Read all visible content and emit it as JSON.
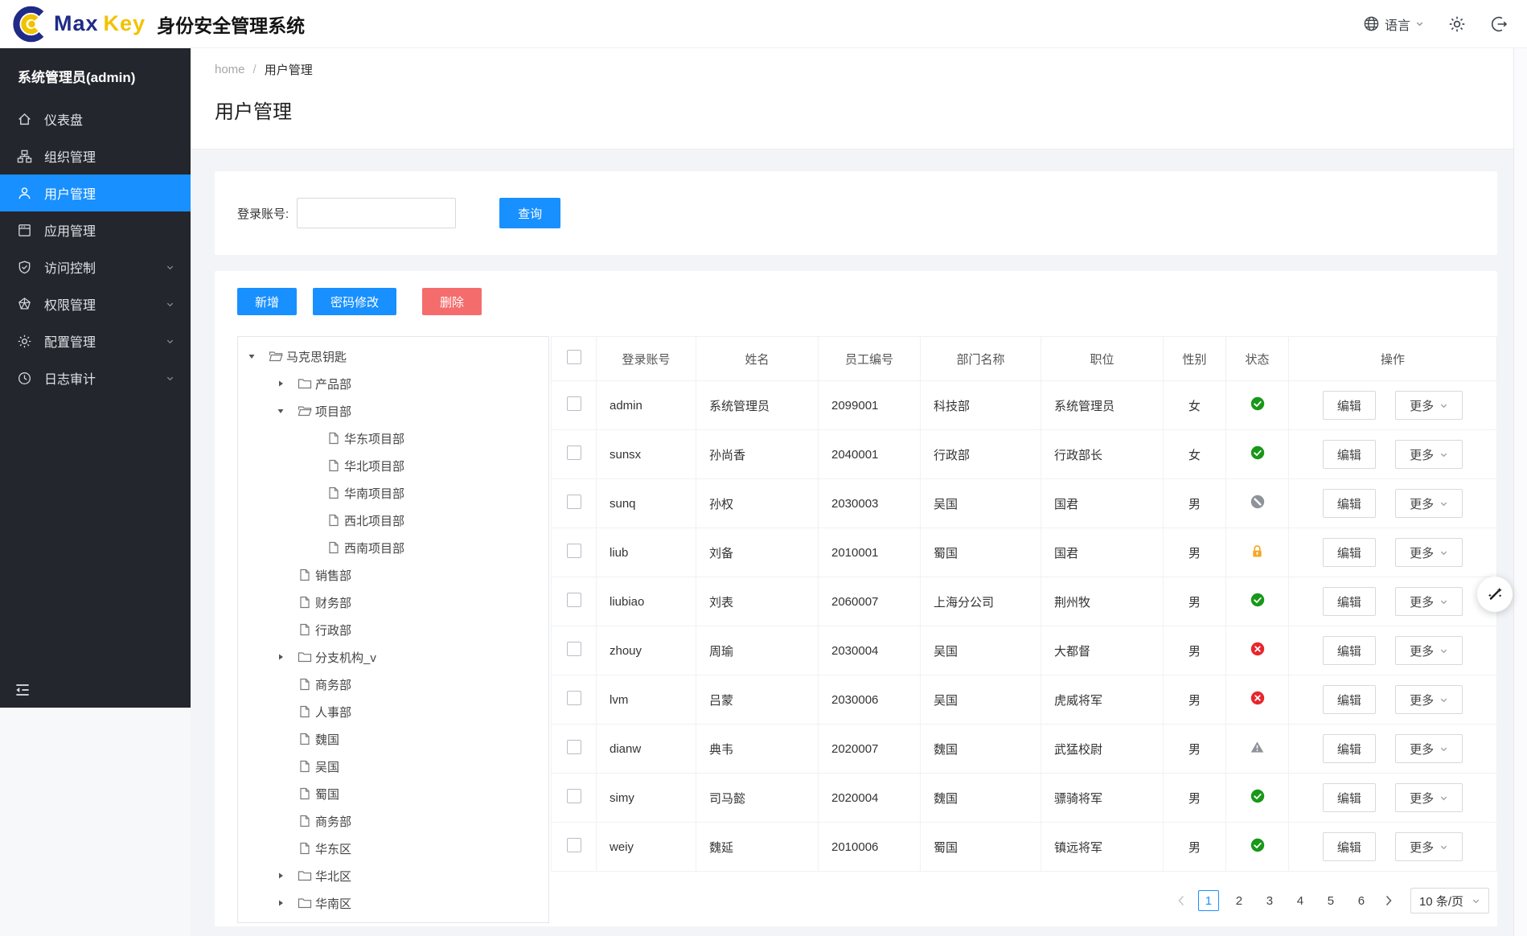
{
  "navbar": {
    "brand": {
      "max": "Max",
      "key": "Key",
      "title": "身份安全管理系统"
    },
    "language_label": "语言",
    "icons": [
      "maxkey-logo",
      "globe-icon",
      "chevron-down-icon",
      "gear-icon",
      "logout-icon"
    ]
  },
  "sidebar": {
    "user": "系统管理员(admin)",
    "items": [
      {
        "icon": "dashboard-icon",
        "label": "仪表盘",
        "active": false,
        "expandable": false
      },
      {
        "icon": "org-icon",
        "label": "组织管理",
        "active": false,
        "expandable": false
      },
      {
        "icon": "user-icon",
        "label": "用户管理",
        "active": true,
        "expandable": false
      },
      {
        "icon": "app-icon",
        "label": "应用管理",
        "active": false,
        "expandable": false
      },
      {
        "icon": "shield-icon",
        "label": "访问控制",
        "active": false,
        "expandable": true
      },
      {
        "icon": "permission-icon",
        "label": "权限管理",
        "active": false,
        "expandable": true
      },
      {
        "icon": "config-icon",
        "label": "配置管理",
        "active": false,
        "expandable": true
      },
      {
        "icon": "audit-icon",
        "label": "日志审计",
        "active": false,
        "expandable": true
      }
    ]
  },
  "breadcrumb": {
    "home": "home",
    "separator": "/",
    "current": "用户管理"
  },
  "page": {
    "title": "用户管理"
  },
  "search": {
    "label": "登录账号:",
    "value": "",
    "button": "查询"
  },
  "toolbar": {
    "add": "新增",
    "change_password": "密码修改",
    "delete": "删除"
  },
  "tree": [
    {
      "level": 0,
      "expander": "open",
      "icon": "folder-open-icon",
      "label": "马克思钥匙"
    },
    {
      "level": 1,
      "expander": "closed",
      "icon": "folder-closed-icon",
      "label": "产品部"
    },
    {
      "level": 1,
      "expander": "open",
      "icon": "folder-open-icon",
      "label": "项目部"
    },
    {
      "level": 2,
      "expander": "none",
      "icon": "file-icon",
      "label": "华东项目部"
    },
    {
      "level": 2,
      "expander": "none",
      "icon": "file-icon",
      "label": "华北项目部"
    },
    {
      "level": 2,
      "expander": "none",
      "icon": "file-icon",
      "label": "华南项目部"
    },
    {
      "level": 2,
      "expander": "none",
      "icon": "file-icon",
      "label": "西北项目部"
    },
    {
      "level": 2,
      "expander": "none",
      "icon": "file-icon",
      "label": "西南项目部"
    },
    {
      "level": 1,
      "expander": "none",
      "icon": "file-icon",
      "label": "销售部"
    },
    {
      "level": 1,
      "expander": "none",
      "icon": "file-icon",
      "label": "财务部"
    },
    {
      "level": 1,
      "expander": "none",
      "icon": "file-icon",
      "label": "行政部"
    },
    {
      "level": 1,
      "expander": "closed",
      "icon": "folder-closed-icon",
      "label": "分支机构_v"
    },
    {
      "level": 1,
      "expander": "none",
      "icon": "file-icon",
      "label": "商务部"
    },
    {
      "level": 1,
      "expander": "none",
      "icon": "file-icon",
      "label": "人事部"
    },
    {
      "level": 1,
      "expander": "none",
      "icon": "file-icon",
      "label": "魏国"
    },
    {
      "level": 1,
      "expander": "none",
      "icon": "file-icon",
      "label": "吴国"
    },
    {
      "level": 1,
      "expander": "none",
      "icon": "file-icon",
      "label": "蜀国"
    },
    {
      "level": 1,
      "expander": "none",
      "icon": "file-icon",
      "label": "商务部"
    },
    {
      "level": 1,
      "expander": "none",
      "icon": "file-icon",
      "label": "华东区"
    },
    {
      "level": 1,
      "expander": "closed",
      "icon": "folder-closed-icon",
      "label": "华北区"
    },
    {
      "level": 1,
      "expander": "closed",
      "icon": "folder-closed-icon",
      "label": "华南区"
    }
  ],
  "table": {
    "headers": [
      "登录账号",
      "姓名",
      "员工编号",
      "部门名称",
      "职位",
      "性别",
      "状态",
      "操作"
    ],
    "actions": {
      "edit": "编辑",
      "more": "更多"
    },
    "rows": [
      {
        "account": "admin",
        "name": "系统管理员",
        "employee_no": "2099001",
        "department": "科技部",
        "position": "系统管理员",
        "gender": "女",
        "status": "active"
      },
      {
        "account": "sunsx",
        "name": "孙尚香",
        "employee_no": "2040001",
        "department": "行政部",
        "position": "行政部长",
        "gender": "女",
        "status": "active"
      },
      {
        "account": "sunq",
        "name": "孙权",
        "employee_no": "2030003",
        "department": "吴国",
        "position": "国君",
        "gender": "男",
        "status": "disabled"
      },
      {
        "account": "liub",
        "name": "刘备",
        "employee_no": "2010001",
        "department": "蜀国",
        "position": "国君",
        "gender": "男",
        "status": "locked"
      },
      {
        "account": "liubiao",
        "name": "刘表",
        "employee_no": "2060007",
        "department": "上海分公司",
        "position": "荆州牧",
        "gender": "男",
        "status": "active"
      },
      {
        "account": "zhouy",
        "name": "周瑜",
        "employee_no": "2030004",
        "department": "吴国",
        "position": "大都督",
        "gender": "男",
        "status": "inactive"
      },
      {
        "account": "lvm",
        "name": "吕蒙",
        "employee_no": "2030006",
        "department": "吴国",
        "position": "虎威将军",
        "gender": "男",
        "status": "inactive"
      },
      {
        "account": "dianw",
        "name": "典韦",
        "employee_no": "2020007",
        "department": "魏国",
        "position": "武猛校尉",
        "gender": "男",
        "status": "warning"
      },
      {
        "account": "simy",
        "name": "司马懿",
        "employee_no": "2020004",
        "department": "魏国",
        "position": "骠骑将军",
        "gender": "男",
        "status": "active"
      },
      {
        "account": "weiy",
        "name": "魏延",
        "employee_no": "2010006",
        "department": "蜀国",
        "position": "镇远将军",
        "gender": "男",
        "status": "active"
      }
    ]
  },
  "pagination": {
    "pages": [
      "1",
      "2",
      "3",
      "4",
      "5",
      "6"
    ],
    "active": "1",
    "page_size": "10 条/页"
  },
  "colors": {
    "primary": "#1890ff",
    "danger": "#f56c6c",
    "sidebar_bg": "#23262c",
    "brand_blue": "#1f2b87",
    "brand_gold": "#f2c200",
    "status_active": "#189818",
    "status_inactive": "#e8262d",
    "status_locked": "#f5a623",
    "status_disabled": "#8e9399",
    "status_warning": "#8e9399"
  }
}
